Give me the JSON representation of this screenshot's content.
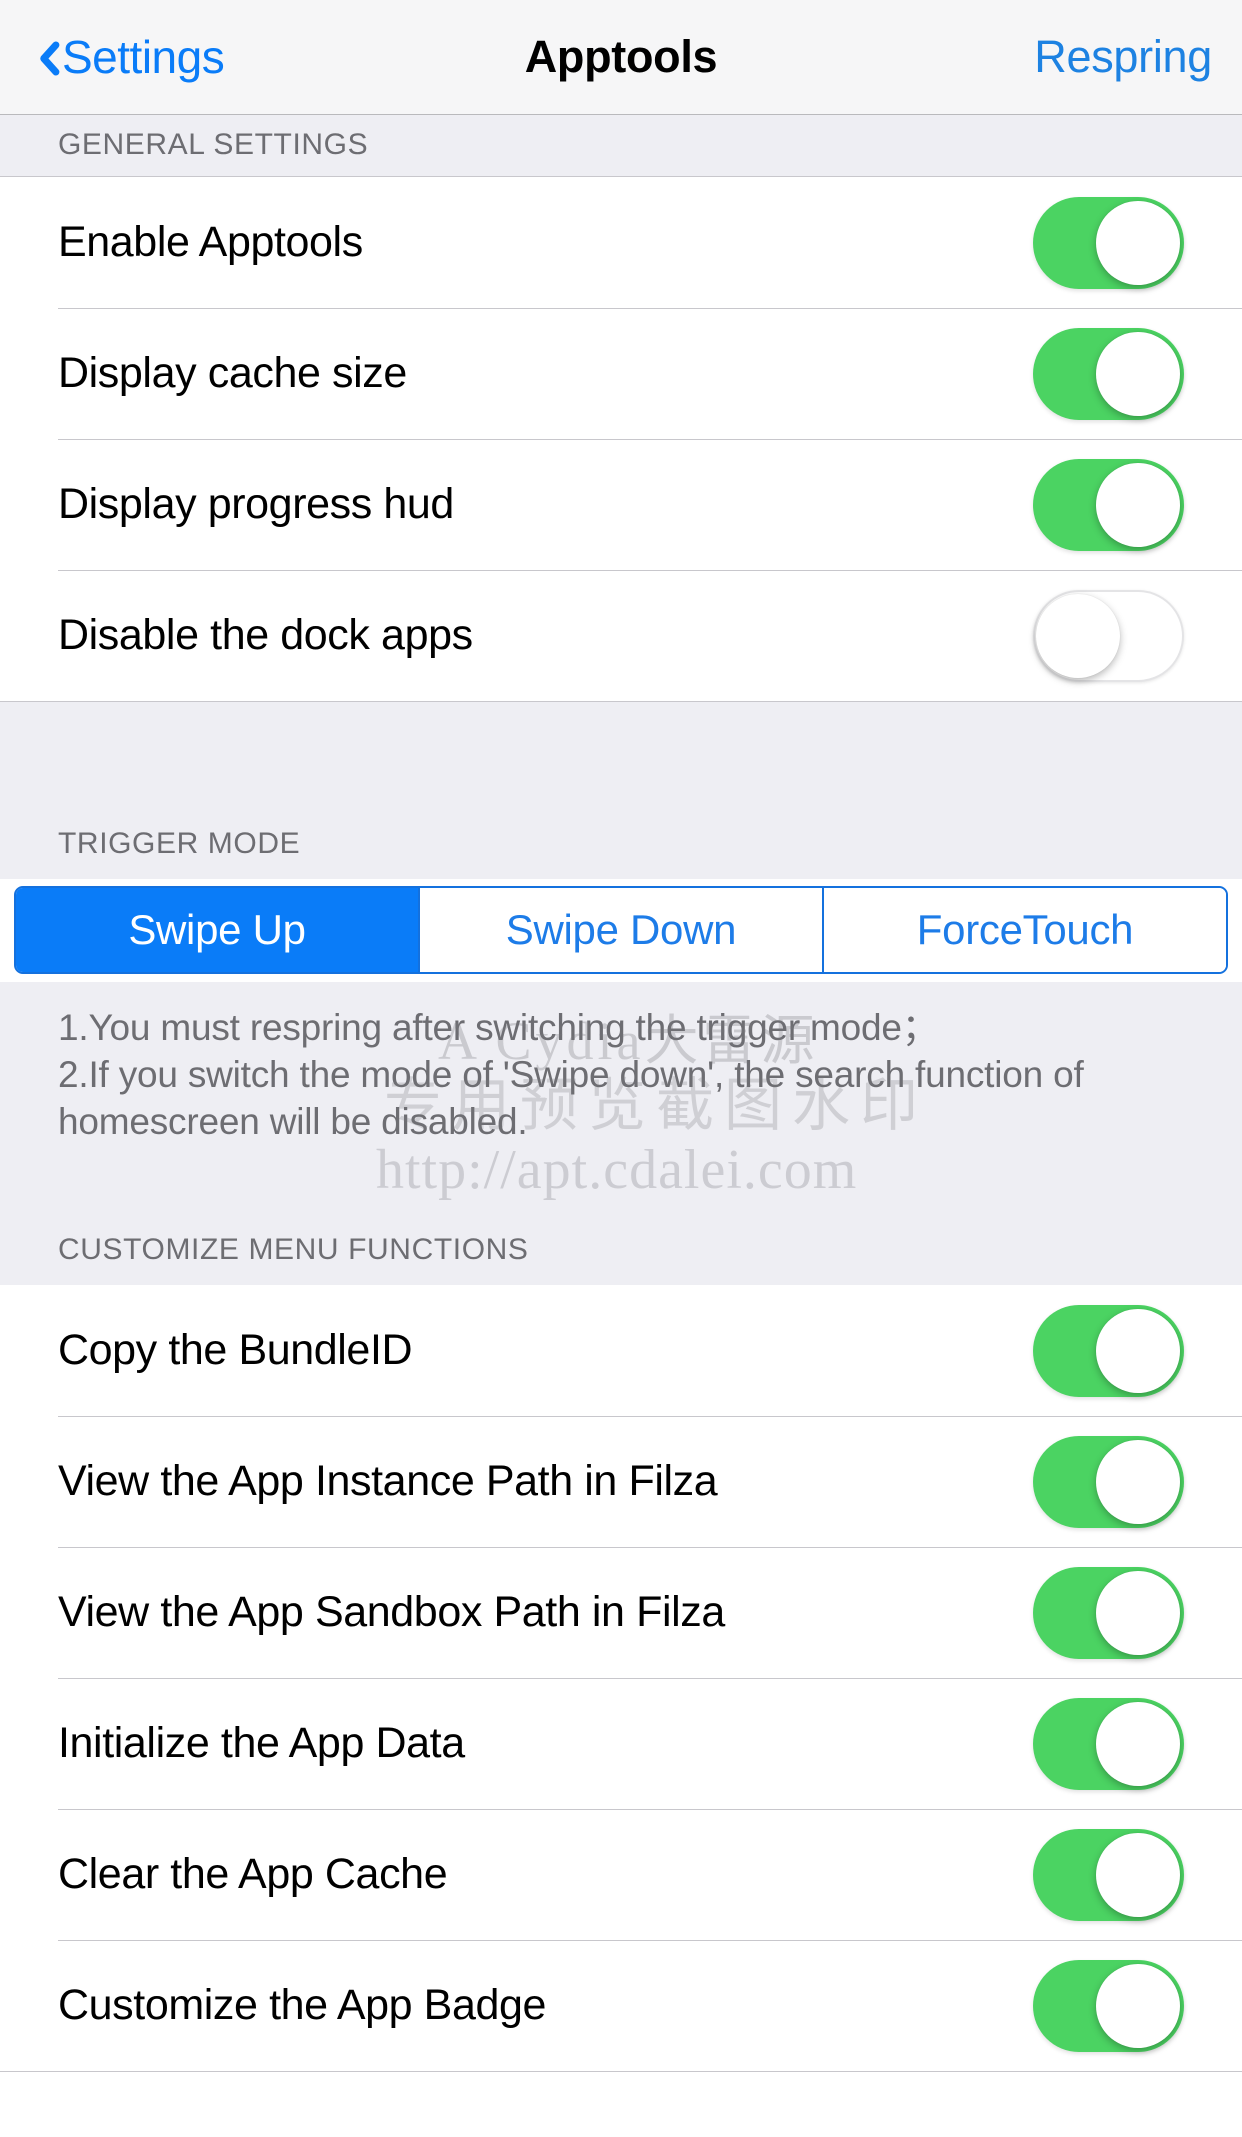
{
  "nav": {
    "back_label": "Settings",
    "title": "Apptools",
    "action_label": "Respring",
    "back_icon": "chevron-left-icon",
    "accent_blue": "#0a7cf8",
    "action_blue": "#1d82e2"
  },
  "sections": {
    "general": {
      "header": "GENERAL SETTINGS",
      "rows": [
        {
          "label": "Enable Apptools",
          "state": "on"
        },
        {
          "label": "Display cache size",
          "state": "on"
        },
        {
          "label": "Display progress hud",
          "state": "on"
        },
        {
          "label": "Disable the dock apps",
          "state": "off"
        }
      ]
    },
    "trigger": {
      "header": "TRIGGER MODE",
      "options": [
        {
          "label": "Swipe Up",
          "selected": true
        },
        {
          "label": "Swipe Down",
          "selected": false
        },
        {
          "label": "ForceTouch",
          "selected": false
        }
      ],
      "note": "1.You must respring after switching the trigger mode；\n2.If you switch the  mode of 'Swipe down', the search function of homescreen will be disabled."
    },
    "menu_functions": {
      "header": "CUSTOMIZE MENU FUNCTIONS",
      "rows": [
        {
          "label": "Copy the BundleID",
          "state": "on"
        },
        {
          "label": "View the App Instance Path in Filza",
          "state": "on"
        },
        {
          "label": "View the App Sandbox Path in Filza",
          "state": "on"
        },
        {
          "label": "Initialize the App Data",
          "state": "on"
        },
        {
          "label": "Clear the App Cache",
          "state": "on"
        },
        {
          "label": "Customize the App Badge",
          "state": "on"
        }
      ]
    }
  },
  "watermark": {
    "line1": "A Cydia大雷源",
    "line2": "专用预览截图水印",
    "line3": "http://apt.cdalei.com"
  },
  "colors": {
    "switch_on": "#4bd362",
    "switch_off_track": "#ffffff",
    "segment_active": "#0a7cf8",
    "section_bg": "#eeeef3",
    "separator": "#c8c7cc"
  }
}
